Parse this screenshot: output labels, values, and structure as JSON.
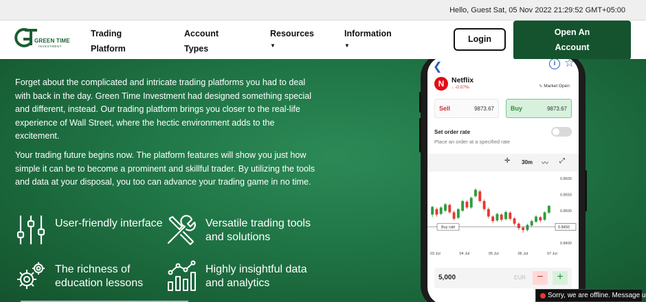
{
  "topbar": {
    "greeting": "Hello, Guest Sat, 05 Nov 2022 21:29:52 GMT+05:00"
  },
  "brand": {
    "logo_name": "GREEN TIME",
    "logo_sub": "INVESTMENT",
    "color": "#14532d"
  },
  "nav": {
    "items": [
      {
        "line1": "Trading",
        "line2": "Platform",
        "has_caret": false
      },
      {
        "line1": "Account",
        "line2": "Types",
        "has_caret": false
      },
      {
        "line1": "Resources",
        "line2": "",
        "has_caret": true
      },
      {
        "line1": "Information",
        "line2": "",
        "has_caret": true
      }
    ],
    "login_label": "Login",
    "open_account_line1": "Open An",
    "open_account_line2": "Account"
  },
  "hero": {
    "para1": "Forget about the complicated and intricate trading platforms you had to deal with back in the day. Green Time Investment had designed something special and different, instead. Our trading platform brings you closer to the real-life experience of Wall Street, where the hectic environment adds to the excitement.",
    "para2": "Your trading future begins now. The platform features will show you just how simple it can be to become a prominent and skillful trader. By utilizing the tools and data at your disposal, you too can advance your trading game in no time.",
    "features": [
      {
        "icon": "sliders-icon",
        "label": "User-friendly interface"
      },
      {
        "icon": "tools-icon",
        "label": "Versatile trading tools and solutions"
      },
      {
        "icon": "gears-icon",
        "label": "The richness of education lessons"
      },
      {
        "icon": "analytics-icon",
        "label": "Highly insightful data and analytics"
      }
    ]
  },
  "phone": {
    "stock_name": "Netflix",
    "stock_change": "-0.07%",
    "market_status": "Market Open",
    "sell_label": "Sell",
    "sell_value": "9873.67",
    "buy_label": "Buy",
    "buy_value": "9873.67",
    "set_order_rate": "Set order rate",
    "set_order_sub": "Place an order at a specified rate",
    "timeframe": "30m",
    "chart": {
      "y_ticks": [
        "0.8600",
        "0.8550",
        "0.8500",
        "0.8450",
        "0.8400"
      ],
      "x_ticks": [
        "03 Jul",
        "04 Jul",
        "05 Jul",
        "06 Jul",
        "07 Jul"
      ],
      "buy_rate_label": "Buy rate",
      "buy_rate_value": "0.8450",
      "candles": [
        [
          0.8488,
          0.8512,
          0.848,
          0.8515,
          "up"
        ],
        [
          0.8505,
          0.8488,
          0.8482,
          0.851,
          "down"
        ],
        [
          0.849,
          0.851,
          0.8486,
          0.8514,
          "up"
        ],
        [
          0.85,
          0.852,
          0.8495,
          0.8524,
          "up"
        ],
        [
          0.8518,
          0.8495,
          0.849,
          0.8522,
          "down"
        ],
        [
          0.8495,
          0.8475,
          0.847,
          0.85,
          "down"
        ],
        [
          0.8478,
          0.8505,
          0.8474,
          0.8508,
          "up"
        ],
        [
          0.85,
          0.853,
          0.8496,
          0.8534,
          "up"
        ],
        [
          0.8528,
          0.851,
          0.8505,
          0.8532,
          "down"
        ],
        [
          0.851,
          0.854,
          0.8506,
          0.8544,
          "up"
        ],
        [
          0.8545,
          0.8565,
          0.854,
          0.857,
          "up"
        ],
        [
          0.856,
          0.853,
          0.8525,
          0.8565,
          "down"
        ],
        [
          0.853,
          0.8505,
          0.85,
          0.8535,
          "down"
        ],
        [
          0.8505,
          0.8482,
          0.8476,
          0.851,
          "down"
        ],
        [
          0.8482,
          0.8468,
          0.8462,
          0.8486,
          "down"
        ],
        [
          0.847,
          0.849,
          0.8466,
          0.8494,
          "up"
        ],
        [
          0.8488,
          0.8472,
          0.8466,
          0.8492,
          "down"
        ],
        [
          0.8474,
          0.8496,
          0.847,
          0.85,
          "up"
        ],
        [
          0.8494,
          0.8475,
          0.847,
          0.8498,
          "down"
        ],
        [
          0.8476,
          0.846,
          0.8454,
          0.848,
          "down"
        ],
        [
          0.846,
          0.8446,
          0.844,
          0.8464,
          "down"
        ],
        [
          0.8448,
          0.844,
          0.8432,
          0.8452,
          "down"
        ],
        [
          0.844,
          0.8456,
          0.8436,
          0.846,
          "up"
        ],
        [
          0.8454,
          0.8468,
          0.845,
          0.8472,
          "up"
        ],
        [
          0.8466,
          0.8482,
          0.8462,
          0.8486,
          "up"
        ],
        [
          0.848,
          0.847,
          0.8464,
          0.8484,
          "down"
        ],
        [
          0.8472,
          0.8495,
          0.8468,
          0.8498,
          "up"
        ],
        [
          0.8494,
          0.8515,
          0.849,
          0.8518,
          "up"
        ]
      ]
    },
    "qty_value": "5,000",
    "qty_unit": "EUR",
    "minus": "−",
    "plus": "+"
  },
  "chat": {
    "text": "Sorry, we are offline. Message us."
  },
  "colors": {
    "candle_up": "#2e9e3e",
    "candle_down": "#e53935",
    "accent_blue": "#2b5bb5"
  }
}
